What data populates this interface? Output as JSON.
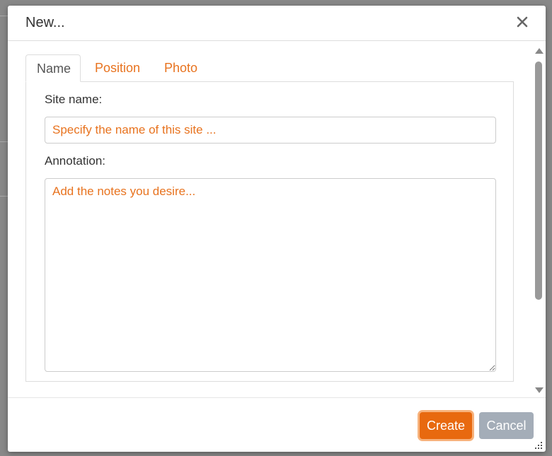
{
  "dialog": {
    "title": "New...",
    "close_icon": "close-icon"
  },
  "tabs": [
    {
      "label": "Name",
      "active": true
    },
    {
      "label": "Position",
      "active": false
    },
    {
      "label": "Photo",
      "active": false
    }
  ],
  "form": {
    "site_name_label": "Site name:",
    "site_name_value": "",
    "site_name_placeholder": "Specify the name of this site ...",
    "annotation_label": "Annotation:",
    "annotation_value": "",
    "annotation_placeholder": "Add the notes you desire..."
  },
  "footer": {
    "create_label": "Create",
    "cancel_label": "Cancel"
  },
  "colors": {
    "accent": "#e8731f",
    "primary_button": "#e8690f",
    "secondary_button": "#a4adb8"
  }
}
